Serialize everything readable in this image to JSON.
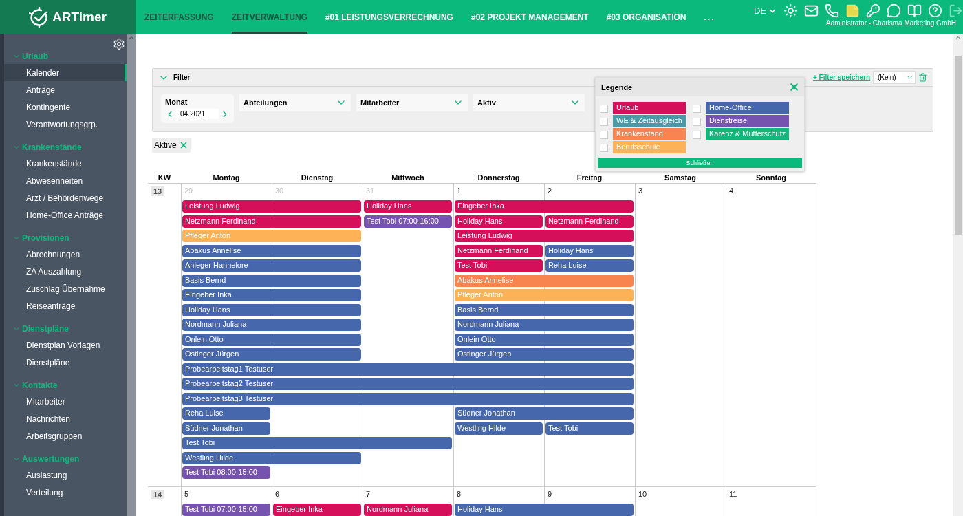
{
  "header": {
    "logo": "ARTimer",
    "language": "DE",
    "user": "Administrator - Charisma Marketing GmbH",
    "nav": [
      {
        "label": "ZEITERFASSUNG",
        "kind": "module",
        "selected": false
      },
      {
        "label": "ZEITVERWALTUNG",
        "kind": "module",
        "selected": true
      },
      {
        "label": "#01 LEISTUNGSVERRECHNUNG",
        "kind": "addon",
        "selected": false
      },
      {
        "label": "#02 PROJEKT MANAGEMENT",
        "kind": "addon",
        "selected": false
      },
      {
        "label": "#03 ORGANISATION",
        "kind": "addon",
        "selected": false
      },
      {
        "label": "...",
        "kind": "more",
        "selected": false
      }
    ]
  },
  "sidebar": {
    "sections": [
      {
        "title": "Urlaub",
        "expanded": true,
        "items": [
          {
            "label": "Kalender",
            "selected": true
          },
          {
            "label": "Anträge",
            "selected": false
          },
          {
            "label": "Kontingente",
            "selected": false
          },
          {
            "label": "Verantwortungsgrp.",
            "selected": false
          }
        ]
      },
      {
        "title": "Krankenstände",
        "expanded": true,
        "items": [
          {
            "label": "Krankenstände",
            "selected": false
          },
          {
            "label": "Abwesenheiten",
            "selected": false
          },
          {
            "label": "Arzt / Behördenwege",
            "selected": false
          },
          {
            "label": "Home-Office Anträge",
            "selected": false
          }
        ]
      },
      {
        "title": "Provisionen",
        "expanded": true,
        "items": [
          {
            "label": "Abrechnungen",
            "selected": false
          },
          {
            "label": "ZA Auszahlung",
            "selected": false
          },
          {
            "label": "Zuschlag Übernahme",
            "selected": false
          },
          {
            "label": "Reiseanträge",
            "selected": false
          }
        ]
      },
      {
        "title": "Dienstpläne",
        "expanded": true,
        "items": [
          {
            "label": "Dienstplan Vorlagen",
            "selected": false
          },
          {
            "label": "Dienstpläne",
            "selected": false
          }
        ]
      },
      {
        "title": "Kontakte",
        "expanded": true,
        "items": [
          {
            "label": "Mitarbeiter",
            "selected": false
          },
          {
            "label": "Nachrichten",
            "selected": false
          },
          {
            "label": "Arbeitsgruppen",
            "selected": false
          }
        ]
      },
      {
        "title": "Auswertungen",
        "expanded": true,
        "items": [
          {
            "label": "Auslastung",
            "selected": false
          },
          {
            "label": "Verteilung",
            "selected": false
          }
        ]
      }
    ]
  },
  "filter": {
    "title": "Filter",
    "expanded": true,
    "save_link": "+ Filter speichern",
    "preset": "(Kein)",
    "month": {
      "label": "Monat",
      "value": "04.2021"
    },
    "dropdowns": [
      "Abteilungen",
      "Mitarbeiter",
      "Aktiv"
    ]
  },
  "legend": {
    "title": "Legende",
    "close_button": "Schließen",
    "items": [
      {
        "label": "Urlaub",
        "color": "#d60f5a",
        "checked": false
      },
      {
        "label": "WE & Zeitausgleich",
        "color": "#4a98a8",
        "checked": false
      },
      {
        "label": "Krankenstand",
        "color": "#f8844f",
        "checked": false
      },
      {
        "label": "Berufsschule",
        "color": "#fdb257",
        "checked": false
      },
      {
        "label": "Home-Office",
        "color": "#4767ad",
        "checked": false
      },
      {
        "label": "Dienstreise",
        "color": "#7753b0",
        "checked": false
      },
      {
        "label": "Karenz & Mutterschutz",
        "color": "#10b67c",
        "checked": false
      }
    ]
  },
  "chips": [
    {
      "label": "Aktive"
    }
  ],
  "calendar": {
    "kw_label": "KW",
    "days": [
      "Montag",
      "Dienstag",
      "Mittwoch",
      "Donnerstag",
      "Freitag",
      "Samstag",
      "Sonntag"
    ],
    "weeks": [
      {
        "kw": "13",
        "dates": [
          {
            "label": "29",
            "other_month": true
          },
          {
            "label": "30",
            "other_month": true
          },
          {
            "label": "31",
            "other_month": true
          },
          {
            "label": "1",
            "other_month": false
          },
          {
            "label": "2",
            "other_month": false
          },
          {
            "label": "3",
            "other_month": false
          },
          {
            "label": "4",
            "other_month": false
          }
        ],
        "lanes": [
          [
            {
              "kind": "start",
              "name": "Leistung Ludwig",
              "color": "#d60f5a"
            },
            {
              "kind": "continue"
            },
            {
              "kind": "start",
              "name": "Holiday Hans",
              "color": "#d60f5a"
            },
            {
              "kind": "start",
              "name": "Eingeber Inka",
              "color": "#d60f5a"
            },
            {
              "kind": "continue"
            }
          ],
          [
            {
              "kind": "start",
              "name": "Netzmann Ferdinand",
              "color": "#d60f5a"
            },
            {
              "kind": "continue"
            },
            {
              "kind": "start",
              "name": "Test Tobi 07:00-16:00",
              "color": "#7753b0"
            },
            {
              "kind": "start",
              "name": "Holiday Hans",
              "color": "#d60f5a"
            },
            {
              "kind": "start",
              "name": "Netzmann Ferdinand",
              "color": "#d60f5a"
            }
          ],
          [
            {
              "kind": "start",
              "name": "Pfleger Anton",
              "color": "#fdb257"
            },
            {
              "kind": "continue"
            },
            {
              "kind": "empty"
            },
            {
              "kind": "start",
              "name": "Leistung Ludwig",
              "color": "#d60f5a"
            },
            {
              "kind": "continue"
            }
          ],
          [
            {
              "kind": "start",
              "name": "Abakus Annelise",
              "color": "#4767ad"
            },
            {
              "kind": "continue"
            },
            {
              "kind": "empty"
            },
            {
              "kind": "start",
              "name": "Netzmann Ferdinand",
              "color": "#d60f5a"
            },
            {
              "kind": "start",
              "name": "Holiday Hans",
              "color": "#4767ad"
            }
          ],
          [
            {
              "kind": "start",
              "name": "Anleger Hannelore",
              "color": "#4767ad"
            },
            {
              "kind": "continue"
            },
            {
              "kind": "empty"
            },
            {
              "kind": "start",
              "name": "Test Tobi",
              "color": "#d60f5a"
            },
            {
              "kind": "start",
              "name": "Reha Luise",
              "color": "#4767ad"
            }
          ],
          [
            {
              "kind": "start",
              "name": "Basis Bernd",
              "color": "#4767ad"
            },
            {
              "kind": "continue"
            },
            {
              "kind": "empty"
            },
            {
              "kind": "start",
              "name": "Abakus Annelise",
              "color": "#f8844f"
            },
            {
              "kind": "continue"
            }
          ],
          [
            {
              "kind": "start",
              "name": "Eingeber Inka",
              "color": "#4767ad"
            },
            {
              "kind": "continue"
            },
            {
              "kind": "empty"
            },
            {
              "kind": "start",
              "name": "Pfleger Anton",
              "color": "#fdb257"
            },
            {
              "kind": "continue"
            }
          ],
          [
            {
              "kind": "start",
              "name": "Holiday Hans",
              "color": "#4767ad"
            },
            {
              "kind": "continue"
            },
            {
              "kind": "empty"
            },
            {
              "kind": "start",
              "name": "Basis Bernd",
              "color": "#4767ad"
            },
            {
              "kind": "continue"
            }
          ],
          [
            {
              "kind": "start",
              "name": "Nordmann Juliana",
              "color": "#4767ad"
            },
            {
              "kind": "continue"
            },
            {
              "kind": "empty"
            },
            {
              "kind": "start",
              "name": "Nordmann Juliana",
              "color": "#4767ad"
            },
            {
              "kind": "continue"
            }
          ],
          [
            {
              "kind": "start",
              "name": "Onlein Otto",
              "color": "#4767ad"
            },
            {
              "kind": "continue"
            },
            {
              "kind": "empty"
            },
            {
              "kind": "start",
              "name": "Onlein Otto",
              "color": "#4767ad"
            },
            {
              "kind": "continue"
            }
          ],
          [
            {
              "kind": "start",
              "name": "Ostinger Jürgen",
              "color": "#4767ad"
            },
            {
              "kind": "continue"
            },
            {
              "kind": "empty"
            },
            {
              "kind": "start",
              "name": "Ostinger Jürgen",
              "color": "#4767ad"
            },
            {
              "kind": "continue"
            }
          ],
          [
            {
              "kind": "start",
              "name": "Probearbeitstag1 Testuser",
              "color": "#4767ad"
            },
            {
              "kind": "continue"
            },
            {
              "kind": "continue"
            },
            {
              "kind": "continue"
            },
            {
              "kind": "continue"
            }
          ],
          [
            {
              "kind": "start",
              "name": "Probearbeitstag2 Testuser",
              "color": "#4767ad"
            },
            {
              "kind": "continue"
            },
            {
              "kind": "continue"
            },
            {
              "kind": "continue"
            },
            {
              "kind": "continue"
            }
          ],
          [
            {
              "kind": "start",
              "name": "Probearbeitstag3 Testuser",
              "color": "#4767ad"
            },
            {
              "kind": "continue"
            },
            {
              "kind": "continue"
            },
            {
              "kind": "continue"
            },
            {
              "kind": "continue"
            }
          ],
          [
            {
              "kind": "start",
              "name": "Reha Luise",
              "color": "#4767ad"
            },
            {
              "kind": "empty"
            },
            {
              "kind": "empty"
            },
            {
              "kind": "start",
              "name": "Südner Jonathan",
              "color": "#4767ad"
            },
            {
              "kind": "continue"
            }
          ],
          [
            {
              "kind": "start",
              "name": "Südner Jonathan",
              "color": "#4767ad"
            },
            {
              "kind": "empty"
            },
            {
              "kind": "empty"
            },
            {
              "kind": "start",
              "name": "Westling Hilde",
              "color": "#4767ad"
            },
            {
              "kind": "start",
              "name": "Test Tobi",
              "color": "#4767ad"
            }
          ],
          [
            {
              "kind": "start",
              "name": "Test Tobi",
              "color": "#4767ad"
            },
            {
              "kind": "continue"
            },
            {
              "kind": "continue"
            }
          ],
          [
            {
              "kind": "start",
              "name": "Westling Hilde",
              "color": "#4767ad"
            },
            {
              "kind": "continue"
            }
          ],
          [
            {
              "kind": "start",
              "name": "Test Tobi 08:00-15:00",
              "color": "#7753b0"
            }
          ]
        ]
      },
      {
        "kw": "14",
        "dates": [
          {
            "label": "5",
            "other_month": false
          },
          {
            "label": "6",
            "other_month": false
          },
          {
            "label": "7",
            "other_month": false
          },
          {
            "label": "8",
            "other_month": false
          },
          {
            "label": "9",
            "other_month": false
          },
          {
            "label": "10",
            "other_month": false
          },
          {
            "label": "11",
            "other_month": false
          }
        ],
        "lanes": [
          [
            {
              "kind": "start",
              "name": "Test Tobi 07:00-15:00",
              "color": "#7753b0"
            },
            {
              "kind": "start",
              "name": "Eingeber Inka",
              "color": "#d60f5a"
            },
            {
              "kind": "start",
              "name": "Nordmann Juliana",
              "color": "#d60f5a"
            },
            {
              "kind": "start",
              "name": "Holiday Hans",
              "color": "#4767ad"
            },
            {
              "kind": "continue"
            }
          ]
        ]
      }
    ]
  }
}
